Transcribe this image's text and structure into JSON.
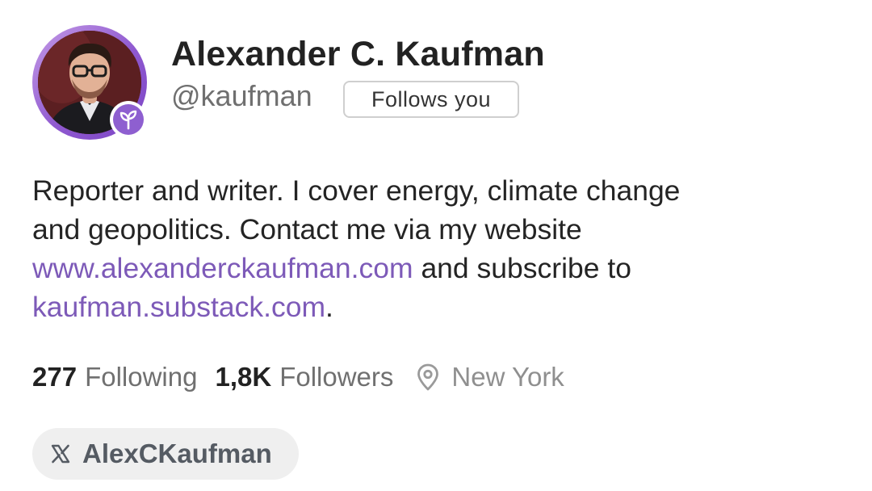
{
  "profile": {
    "display_name": "Alexander C. Kaufman",
    "handle": "@kaufman",
    "follows_you_label": "Follows you",
    "avatar_icon": "profile-photo",
    "badge_icon": "sprout-icon"
  },
  "bio": {
    "line1": "Reporter and writer. I cover energy, climate change",
    "line2": "and geopolitics. Contact me via my website",
    "website_link": "www.alexanderckaufman.com",
    "line3_suffix": " and subscribe to",
    "substack_link": "kaufman.substack.com",
    "line4_suffix": "."
  },
  "stats": {
    "following_count": "277",
    "following_label": "Following",
    "followers_count": "1,8K",
    "followers_label": "Followers",
    "location_icon": "location-pin-icon",
    "location": "New York"
  },
  "social": {
    "platform_icon": "x-icon",
    "handle": "AlexCKaufman"
  },
  "colors": {
    "accent": "#7d5ab8",
    "badge": "#8e5fd0",
    "muted_text": "#707070",
    "pill_background": "#efefef"
  }
}
